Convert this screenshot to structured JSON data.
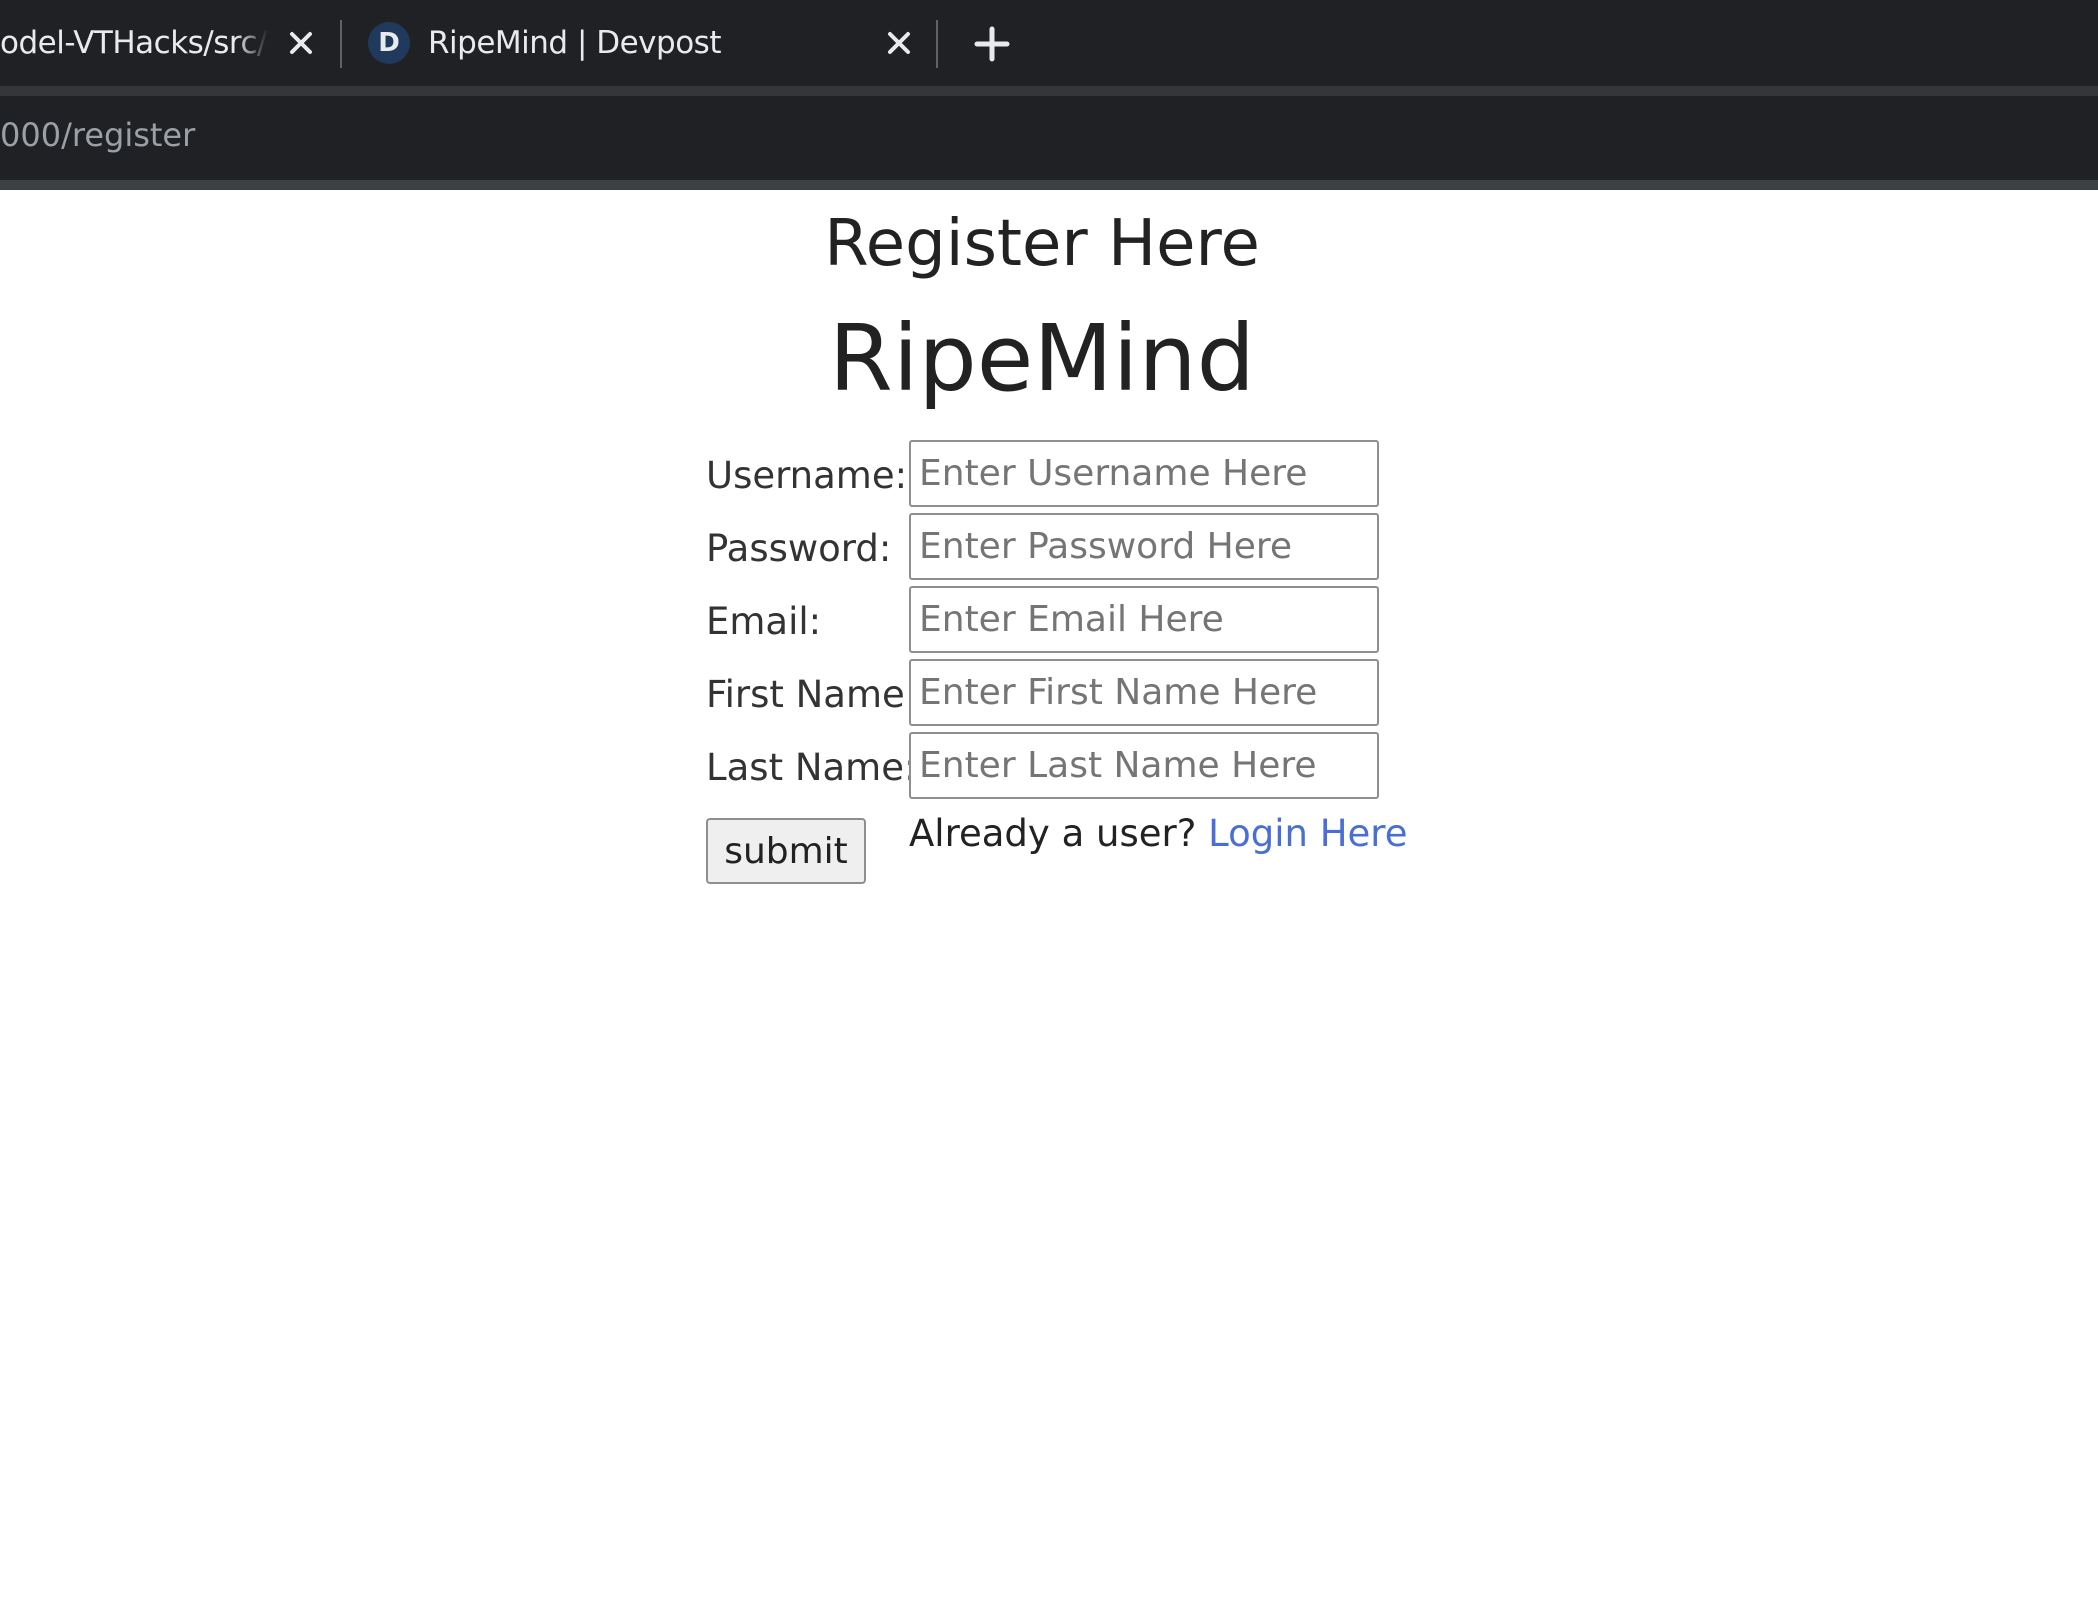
{
  "browser": {
    "tabs": [
      {
        "title": "odel-VTHacks/src/te",
        "active": false
      },
      {
        "title": "RipeMind | Devpost",
        "favicon_letter": "D",
        "active": true
      }
    ],
    "address_bar": {
      "url": "000/register"
    }
  },
  "page": {
    "heading": "Register Here",
    "brand": "RipeMind",
    "form": {
      "fields": [
        {
          "label": "Username:",
          "placeholder": "Enter Username Here",
          "value": ""
        },
        {
          "label": "Password:",
          "placeholder": "Enter Password Here",
          "value": ""
        },
        {
          "label": "Email:",
          "placeholder": "Enter Email Here",
          "value": ""
        },
        {
          "label": "First Name:",
          "placeholder": "Enter First Name Here",
          "value": ""
        },
        {
          "label": "Last Name:",
          "placeholder": "Enter Last Name Here",
          "value": ""
        }
      ],
      "submit_label": "submit"
    },
    "login_prompt": "Already a user?",
    "login_link": "Login Here"
  },
  "colors": {
    "chrome_background": "#202124",
    "link": "#4a6fd4",
    "text": "#222222"
  },
  "icons": [
    "close-icon",
    "plus-icon",
    "devpost-favicon-icon"
  ]
}
